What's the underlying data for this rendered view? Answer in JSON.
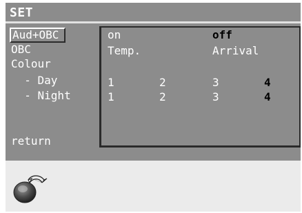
{
  "screen": {
    "title": "SET"
  },
  "menu": {
    "items": [
      "Aud+OBC",
      "OBC",
      "Colour",
      "  - Day",
      "  - Night",
      "return"
    ],
    "selected": "Aud+OBC"
  },
  "rows": {
    "aud_obc": {
      "opt1": "on",
      "opt2": "off",
      "active": "off"
    },
    "obc": {
      "opt1": "Temp.",
      "opt2": "Arrival"
    },
    "day": {
      "v1": "1",
      "v2": "2",
      "v3": "3",
      "v4": "4",
      "active": "4"
    },
    "night": {
      "v1": "1",
      "v2": "2",
      "v3": "3",
      "v4": "4",
      "active": "4"
    }
  },
  "colors": {
    "screen": "#8c8c8c",
    "text": "#ffffff",
    "active_text": "#000000",
    "footer": "#ebebeb"
  },
  "icons": {
    "knob": "rotary-knob-icon",
    "rotate_arrow": "rotate-arrow-icon"
  }
}
